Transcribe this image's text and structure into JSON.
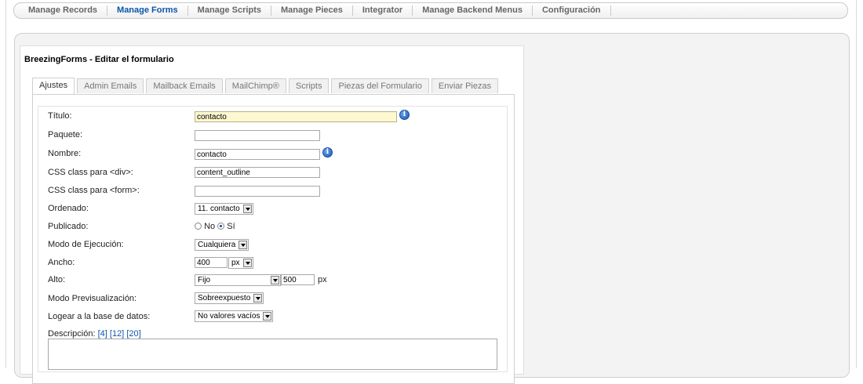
{
  "topnav": {
    "items": [
      "Manage Records",
      "Manage Forms",
      "Manage Scripts",
      "Manage Pieces",
      "Integrator",
      "Manage Backend Menus",
      "Configuración"
    ],
    "active_index": 1
  },
  "card": {
    "title": "BreezingForms - Editar el formulario"
  },
  "tabs": [
    "Ajustes",
    "Admin Emails",
    "Mailback Emails",
    "MailChimp®",
    "Scripts",
    "Piezas del Formulario",
    "Enviar Piezas"
  ],
  "form": {
    "titulo": {
      "label": "Título:",
      "value": "contacto"
    },
    "paquete": {
      "label": "Paquete:",
      "value": ""
    },
    "nombre": {
      "label": "Nombre:",
      "value": "contacto"
    },
    "css_div": {
      "label": "CSS class para <div>:",
      "value": "content_outline"
    },
    "css_form": {
      "label": "CSS class para <form>:",
      "value": ""
    },
    "ordenado": {
      "label": "Ordenado:",
      "value": "11. contacto"
    },
    "publicado": {
      "label": "Publicado:",
      "no": "No",
      "si": "Sí",
      "selected": "Sí"
    },
    "modo_ejecucion": {
      "label": "Modo de Ejecución:",
      "value": "Cualquiera"
    },
    "ancho": {
      "label": "Ancho:",
      "value": "400",
      "unit": "px"
    },
    "alto": {
      "label": "Alto:",
      "mode": "Fijo",
      "value": "500",
      "unit": "px"
    },
    "modo_previsualizacion": {
      "label": "Modo Previsualización:",
      "value": "Sobreexpuesto"
    },
    "logear": {
      "label": "Logear a la base de datos:",
      "value": "No valores vacíos"
    },
    "descripcion": {
      "label": "Descripción:",
      "links": [
        "[4]",
        "[12]",
        "[20]"
      ]
    }
  },
  "colors": {
    "accent": "#0b55a8",
    "highlight_field": "#fdf8d0",
    "info_icon": "#1a57b5"
  }
}
